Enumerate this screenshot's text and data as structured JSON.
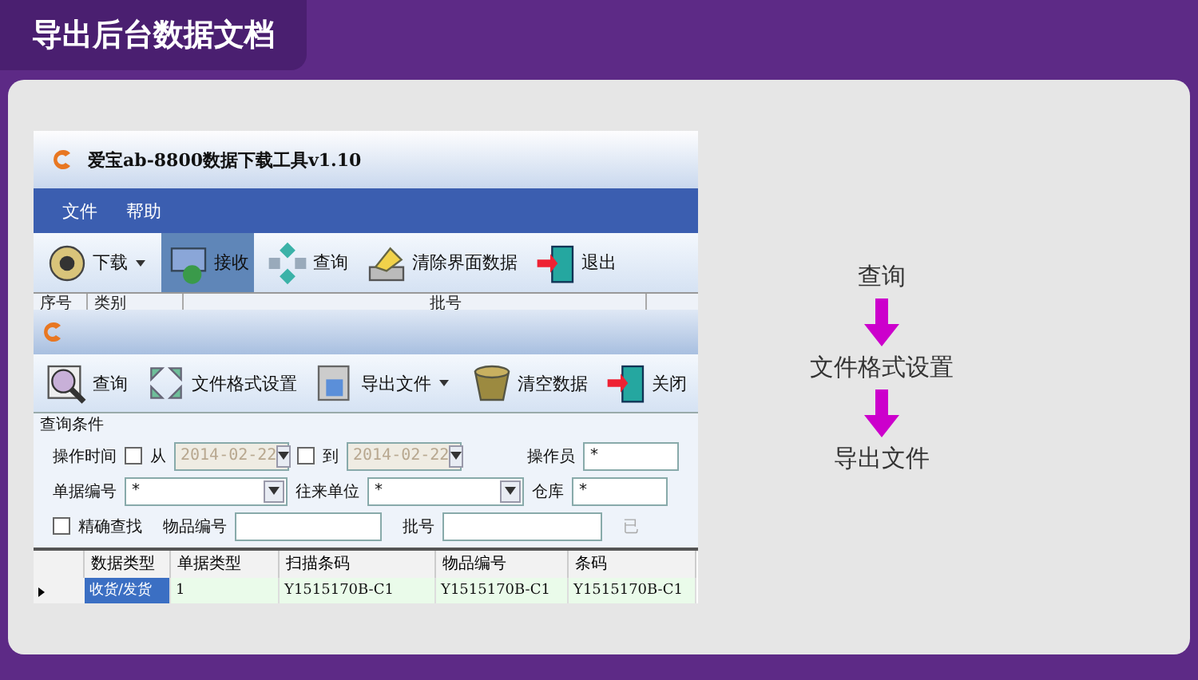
{
  "title": "导出后台数据文档",
  "back_window": {
    "title": "爱宝ab-8800数据下载工具v1.10",
    "menu": [
      "文件",
      "帮助"
    ],
    "toolbar": [
      {
        "label": "下载",
        "dropdown": true,
        "selected": false
      },
      {
        "label": "接收",
        "dropdown": false,
        "selected": true
      },
      {
        "label": "查询",
        "dropdown": false,
        "selected": false
      },
      {
        "label": "清除界面数据",
        "dropdown": false,
        "selected": false
      },
      {
        "label": "退出",
        "dropdown": false,
        "selected": false
      }
    ],
    "columns": [
      "序号",
      "类别",
      "批号"
    ]
  },
  "front_window": {
    "toolbar": [
      {
        "label": "查询",
        "dropdown": false
      },
      {
        "label": "文件格式设置",
        "dropdown": false
      },
      {
        "label": "导出文件",
        "dropdown": true
      },
      {
        "label": "清空数据",
        "dropdown": false
      },
      {
        "label": "关闭",
        "dropdown": false
      }
    ],
    "query": {
      "legend": "查询条件",
      "time_label": "操作时间",
      "from": {
        "label": "从",
        "checked": false,
        "value": "2014-02-22"
      },
      "to": {
        "label": "到",
        "checked": false,
        "value": "2014-02-22"
      },
      "operator": {
        "label": "操作员",
        "value": "*"
      },
      "doc_no": {
        "label": "单据编号",
        "value": "*"
      },
      "partner": {
        "label": "往来单位",
        "value": "*"
      },
      "warehouse": {
        "label": "仓库",
        "value": "*"
      },
      "exact": {
        "label": "精确查找",
        "checked": false
      },
      "item_no": {
        "label": "物品编号"
      },
      "batch": {
        "label": "批号"
      },
      "cut_text": "已"
    },
    "grid": {
      "columns": [
        "数据类型",
        "单据类型",
        "扫描条码",
        "物品编号",
        "条码"
      ],
      "rows": [
        {
          "selected": true,
          "cells": [
            "收货/发货",
            "1",
            "Y1515170B-C1",
            "Y1515170B-C1",
            "Y1515170B-C1"
          ]
        }
      ]
    }
  },
  "flow": [
    "查询",
    "文件格式设置",
    "导出文件"
  ]
}
